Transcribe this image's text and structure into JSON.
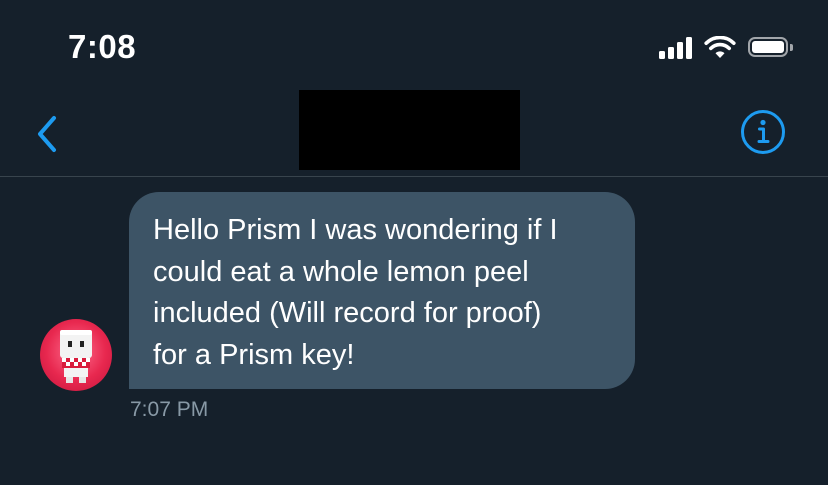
{
  "status": {
    "time": "7:08"
  },
  "conversation": {
    "title": "",
    "messages": [
      {
        "text": "Hello Prism I was wondering if I\ncould eat a whole lemon peel\nincluded (Will record for proof)\nfor a Prism key!",
        "time": "7:07 PM"
      }
    ]
  },
  "colors": {
    "background": "#15202b",
    "bubble": "#3d5466",
    "accent": "#1d9bf0",
    "timestamp": "#8899a6"
  },
  "icons": {
    "back": "chevron-left-icon",
    "info": "info-icon",
    "signal": "signal-icon",
    "wifi": "wifi-icon",
    "battery": "battery-icon"
  }
}
